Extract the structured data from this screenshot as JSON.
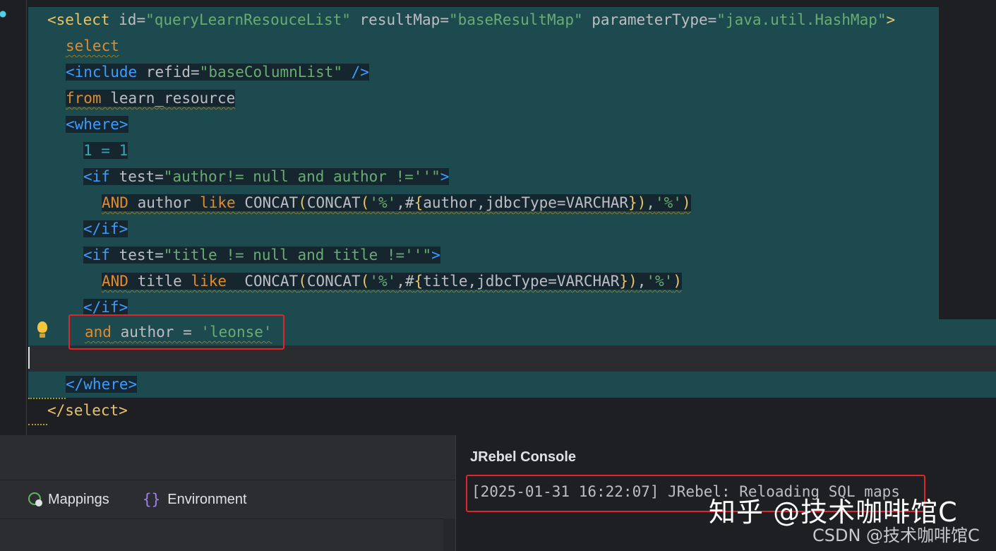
{
  "editor": {
    "lines": [
      {
        "parts": [
          "<select",
          " id=",
          "\"queryLearnResouceList\"",
          " resultMap=",
          "\"baseResultMap\"",
          " parameterType=",
          "\"java.util.HashMap\"",
          ">"
        ]
      },
      {
        "text": "select"
      },
      {
        "parts": [
          "<include",
          " refid=",
          "\"baseColumnList\"",
          " />"
        ]
      },
      {
        "parts": [
          "from",
          " learn_resource"
        ]
      },
      {
        "text": "<where>"
      },
      {
        "text": "1 = 1"
      },
      {
        "parts": [
          "<if",
          " test=",
          "\"author!= null and author !=''\"",
          ">"
        ]
      },
      {
        "parts": [
          "AND",
          " author ",
          "like",
          " CONCAT",
          "(",
          "CONCAT",
          "(",
          "'%'",
          ",#",
          "{",
          "author,jdbcType=VARCHAR",
          "}",
          ")",
          ",",
          "'%'",
          ")"
        ]
      },
      {
        "text": "</if>"
      },
      {
        "parts": [
          "<if",
          " test=",
          "\"title != null and title !=''\"",
          ">"
        ]
      },
      {
        "parts": [
          "AND",
          " title ",
          "like",
          "  CONCAT",
          "(",
          "CONCAT",
          "(",
          "'%'",
          ",#",
          "{",
          "title,jdbcType=VARCHAR",
          "}",
          ")",
          ",",
          "'%'",
          ")"
        ]
      },
      {
        "text": "</if>"
      },
      {
        "parts": [
          "and",
          " author = ",
          "'leonse'"
        ]
      },
      {
        "text": ""
      },
      {
        "text": "</where>"
      },
      {
        "text": "</select>"
      }
    ]
  },
  "colors": {
    "editor_bg": "#1e1f22",
    "selection_highlight": "#1d4a4f",
    "xml_tag": "#e8c46a",
    "xml_tag_blue": "#3c9cff",
    "string": "#6aab73",
    "keyword": "#e08b2e",
    "number": "#2aacb8",
    "annotation_box": "#e0262a"
  },
  "bottom_left": {
    "tabs": [
      {
        "label": "Mappings",
        "icon": "mappings-icon"
      },
      {
        "label": "Environment",
        "icon": "braces-icon"
      }
    ]
  },
  "console": {
    "title": "JRebel Console",
    "line": "[2025-01-31 16:22:07] JRebel: Reloading SQL maps"
  },
  "watermark": {
    "main": "知乎 @技术咖啡馆C",
    "secondary": "CSDN @技术咖啡馆C"
  }
}
